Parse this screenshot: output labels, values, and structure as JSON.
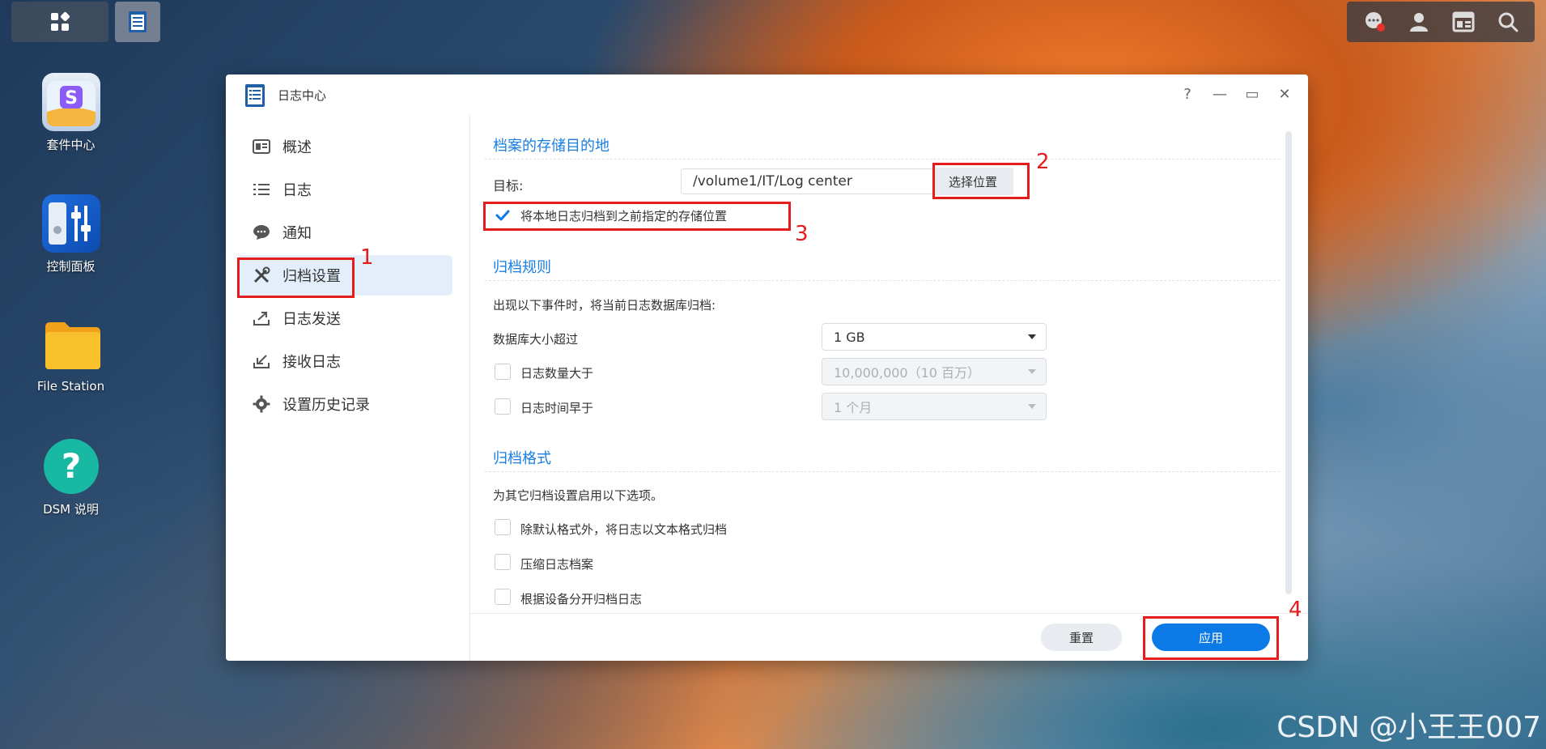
{
  "desktop": {
    "icons": [
      {
        "label": "套件中心"
      },
      {
        "label": "控制面板"
      },
      {
        "label": "File Station"
      },
      {
        "label": "DSM 说明"
      }
    ]
  },
  "window": {
    "title": "日志中心",
    "controls": {
      "help": "?",
      "minimize": "—",
      "maximize": "▭",
      "close": "✕"
    }
  },
  "sidebar": {
    "items": [
      {
        "label": "概述"
      },
      {
        "label": "日志"
      },
      {
        "label": "通知"
      },
      {
        "label": "归档设置",
        "active": true
      },
      {
        "label": "日志发送"
      },
      {
        "label": "接收日志"
      },
      {
        "label": "设置历史记录"
      }
    ]
  },
  "storage": {
    "title": "档案的存储目的地",
    "target_label": "目标:",
    "target_value": "/volume1/IT/Log center",
    "choose_button": "选择位置",
    "archive_checkbox_label": "将本地日志归档到之前指定的存储位置",
    "archive_checked": true
  },
  "rules": {
    "title": "归档规则",
    "description": "出现以下事件时，将当前日志数据库归档:",
    "db_size_label": "数据库大小超过",
    "db_size_value": "1 GB",
    "log_count_label": "日志数量大于",
    "log_count_value": "10,000,000（10 百万）",
    "log_time_label": "日志时间早于",
    "log_time_value": "1 个月"
  },
  "format": {
    "title": "归档格式",
    "description": "为其它归档设置启用以下选项。",
    "opt_text": "除默认格式外，将日志以文本格式归档",
    "opt_compress": "压缩日志档案",
    "opt_by_device": "根据设备分开归档日志"
  },
  "footer": {
    "reset": "重置",
    "apply": "应用"
  },
  "annotations": [
    "1",
    "2",
    "3",
    "4"
  ],
  "watermark": "CSDN @小王王007",
  "colors": {
    "accent": "#0b7ae6",
    "section_title": "#1a7ee0",
    "annotation_red": "#e51c1c"
  }
}
